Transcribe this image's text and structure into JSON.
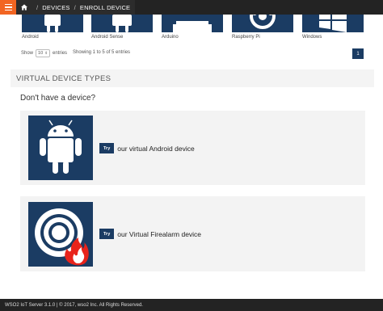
{
  "breadcrumb": {
    "home_icon": "home-icon",
    "items": [
      "DEVICES",
      "ENROLL DEVICE"
    ],
    "separator": "/"
  },
  "devices": [
    {
      "label": "Android",
      "icon": "android-icon"
    },
    {
      "label": "Android Sense",
      "icon": "android-sense-icon"
    },
    {
      "label": "Arduino",
      "icon": "arduino-icon"
    },
    {
      "label": "Raspberry Pi",
      "icon": "raspberry-pi-icon"
    },
    {
      "label": "Windows",
      "icon": "windows-icon"
    }
  ],
  "table_controls": {
    "show_label": "Show",
    "entries_value": "10",
    "entries_label": "entries",
    "info": "Showing 1 to 5 of 5 entries",
    "page": "1"
  },
  "section": {
    "title": "VIRTUAL DEVICE TYPES",
    "question": "Don't have a device?"
  },
  "virtual_devices": [
    {
      "button": "Try",
      "text": "our virtual Android device",
      "icon": "android-robot-icon"
    },
    {
      "button": "Try",
      "text": "our Virtual Firealarm device",
      "icon": "firealarm-icon"
    }
  ],
  "footer": {
    "text": "WSO2 IoT Server 3.1.0 | © 2017, wso2 Inc. All Rights Reserved."
  },
  "colors": {
    "brand": "#1b3c63",
    "accent": "#f26522",
    "topbar": "#232323"
  }
}
